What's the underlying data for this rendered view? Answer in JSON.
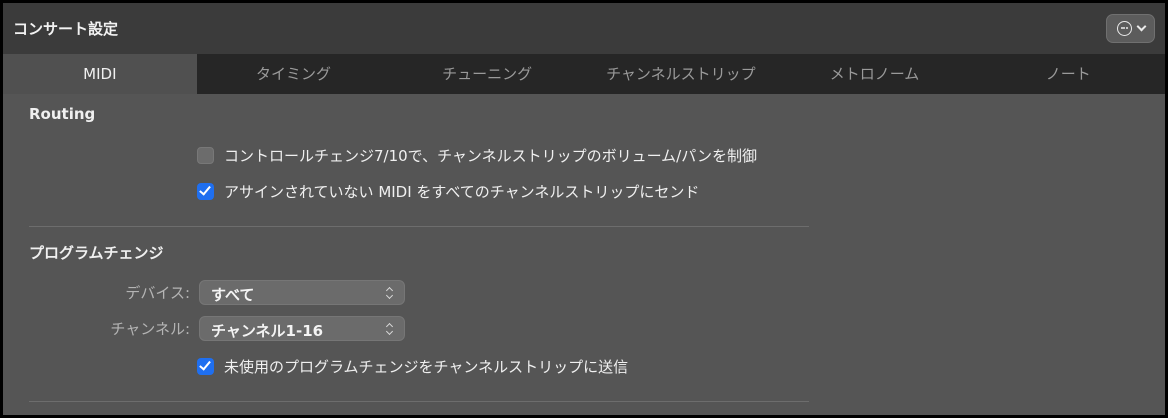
{
  "window": {
    "title": "コンサート設定",
    "more_icon": "ellipsis-circle-icon"
  },
  "tabs": [
    {
      "label": "MIDI",
      "active": true
    },
    {
      "label": "タイミング",
      "active": false
    },
    {
      "label": "チューニング",
      "active": false
    },
    {
      "label": "チャンネルストリップ",
      "active": false
    },
    {
      "label": "メトロノーム",
      "active": false
    },
    {
      "label": "ノート",
      "active": false
    }
  ],
  "routing": {
    "title": "Routing",
    "cc_control": {
      "label": "コントロールチェンジ7/10で、チャンネルストリップのボリューム/パンを制御",
      "checked": false
    },
    "send_unassigned": {
      "label": "アサインされていない MIDI をすべてのチャンネルストリップにセンド",
      "checked": true
    }
  },
  "program_change": {
    "title": "プログラムチェンジ",
    "device": {
      "label": "デバイス:",
      "value": "すべて"
    },
    "channel": {
      "label": "チャンネル:",
      "value": "チャンネル1-16"
    },
    "send_unused": {
      "label": "未使用のプログラムチェンジをチャンネルストリップに送信",
      "checked": true
    }
  },
  "colors": {
    "accent": "#1f6ff0",
    "background": "#555555",
    "tab_bar": "#262626"
  }
}
